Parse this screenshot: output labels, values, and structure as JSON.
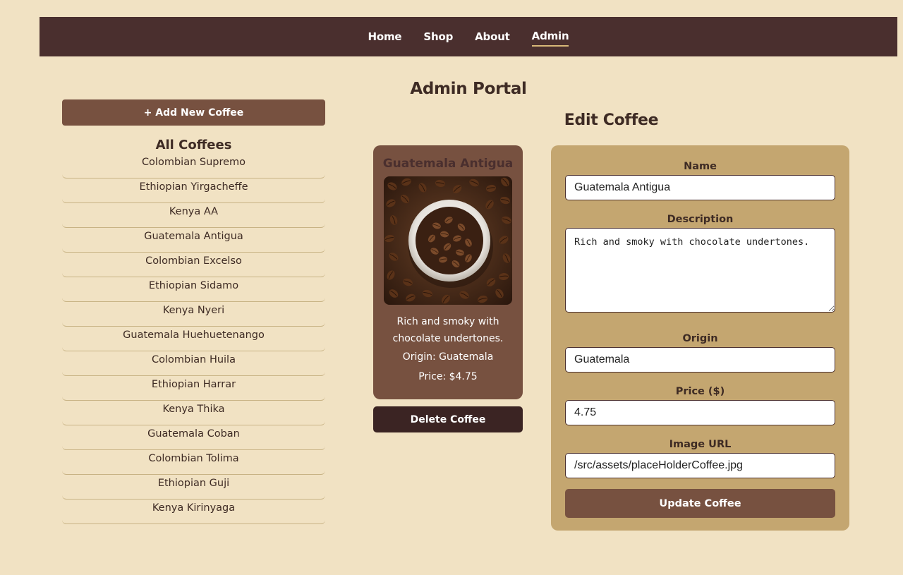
{
  "nav": {
    "items": [
      {
        "label": "Home"
      },
      {
        "label": "Shop"
      },
      {
        "label": "About"
      },
      {
        "label": "Admin"
      }
    ]
  },
  "page": {
    "title": "Admin Portal",
    "edit_title": "Edit Coffee"
  },
  "sidebar": {
    "add_button": "+ Add New Coffee",
    "list_title": "All Coffees",
    "coffees": [
      "Colombian Supremo",
      "Ethiopian Yirgacheffe",
      "Kenya AA",
      "Guatemala Antigua",
      "Colombian Excelso",
      "Ethiopian Sidamo",
      "Kenya Nyeri",
      "Guatemala Huehuetenango",
      "Colombian Huila",
      "Ethiopian Harrar",
      "Kenya Thika",
      "Guatemala Coban",
      "Colombian Tolima",
      "Ethiopian Guji",
      "Kenya Kirinyaga"
    ]
  },
  "preview": {
    "name": "Guatemala Antigua",
    "description": "Rich and smoky with chocolate undertones.",
    "origin": "Origin: Guatemala",
    "price": "Price: $4.75",
    "delete_button": "Delete Coffee"
  },
  "form": {
    "name_label": "Name",
    "name_value": "Guatemala Antigua",
    "description_label": "Description",
    "description_value": "Rich and smoky with chocolate undertones.",
    "origin_label": "Origin",
    "origin_value": "Guatemala",
    "price_label": "Price ($)",
    "price_value": "4.75",
    "image_label": "Image URL",
    "image_value": "/src/assets/placeHolderCoffee.jpg",
    "update_button": "Update Coffee"
  },
  "colors": {
    "background": "#f1e2c3",
    "navbar": "#4a2f2e",
    "accent_brown": "#775140",
    "form_panel": "#c4a670",
    "delete": "#3b2423"
  }
}
